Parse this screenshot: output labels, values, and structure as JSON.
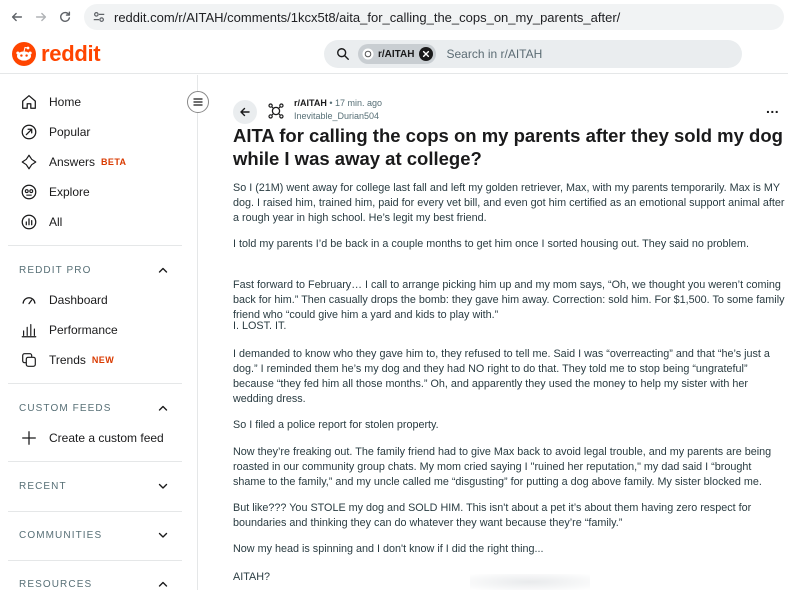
{
  "browser": {
    "url": "reddit.com/r/AITAH/comments/1kcx5t8/aita_for_calling_the_cops_on_my_parents_after/"
  },
  "header": {
    "logo_text": "reddit",
    "search_chip": "r/AITAH",
    "search_placeholder": "Search in r/AITAH",
    "brand_color": "#ff4500"
  },
  "sidebar": {
    "main": [
      {
        "label": "Home",
        "icon": "home-icon"
      },
      {
        "label": "Popular",
        "icon": "popular-icon"
      },
      {
        "label": "Answers",
        "badge": "BETA",
        "icon": "answers-icon"
      },
      {
        "label": "Explore",
        "icon": "explore-icon"
      },
      {
        "label": "All",
        "icon": "all-icon"
      }
    ],
    "reddit_pro": {
      "title": "REDDIT PRO",
      "items": [
        {
          "label": "Dashboard",
          "icon": "dashboard-icon"
        },
        {
          "label": "Performance",
          "icon": "performance-icon"
        },
        {
          "label": "Trends",
          "badge": "NEW",
          "icon": "trends-icon"
        }
      ]
    },
    "custom_feeds": {
      "title": "CUSTOM FEEDS",
      "create_label": "Create a custom feed"
    },
    "recent": {
      "title": "RECENT"
    },
    "communities": {
      "title": "COMMUNITIES"
    },
    "resources": {
      "title": "RESOURCES"
    }
  },
  "post": {
    "subreddit": "r/AITAH",
    "dot": "•",
    "time": "17 min. ago",
    "author": "Inevitable_Durian504",
    "more": "...",
    "title": "AITA for calling the cops on my parents after they sold my dog while I was away at college?",
    "paragraphs": [
      "So I (21M) went away for college last fall and left my golden retriever, Max, with my parents temporarily. Max is MY dog. I raised him, trained him, paid for every vet bill, and even got him certified as an emotional support animal after a rough year in high school. He’s legit my best friend.",
      "I told my parents I’d be back in a couple months to get him once I sorted housing out. They said no problem.",
      "Fast forward to February… I call to arrange picking him up and my mom says, “Oh, we thought you weren’t coming back for him.” Then casually drops the bomb: they gave him away. Correction: sold him. For $1,500. To some family friend who “could give him a yard and kids to play with.”",
      "I. LOST. IT.",
      "I demanded to know who they gave him to, they refused to tell me. Said I was “overreacting” and that “he’s just a dog.” I reminded them he’s my dog and they had NO right to do that. They told me to stop being “ungrateful” because “they fed him all those months.” Oh, and apparently they used the money to help my sister with her wedding dress.",
      "So I filed a police report for stolen property.",
      "Now they’re freaking out. The family friend had to give Max back to avoid legal trouble, and my parents are being roasted in our community group chats. My mom cried saying I \"ruined her reputation,\" my dad said I “brought shame to the family,” and my uncle called me “disgusting” for putting a dog above family. My sister blocked me.",
      "But like??? You STOLE my dog and SOLD HIM. This isn't about a pet it’s about them having zero respect for boundaries and thinking they can do whatever they want because they’re “family.”",
      "Now my head is spinning and I don't know if I did the right thing...",
      "AITAH?"
    ]
  }
}
